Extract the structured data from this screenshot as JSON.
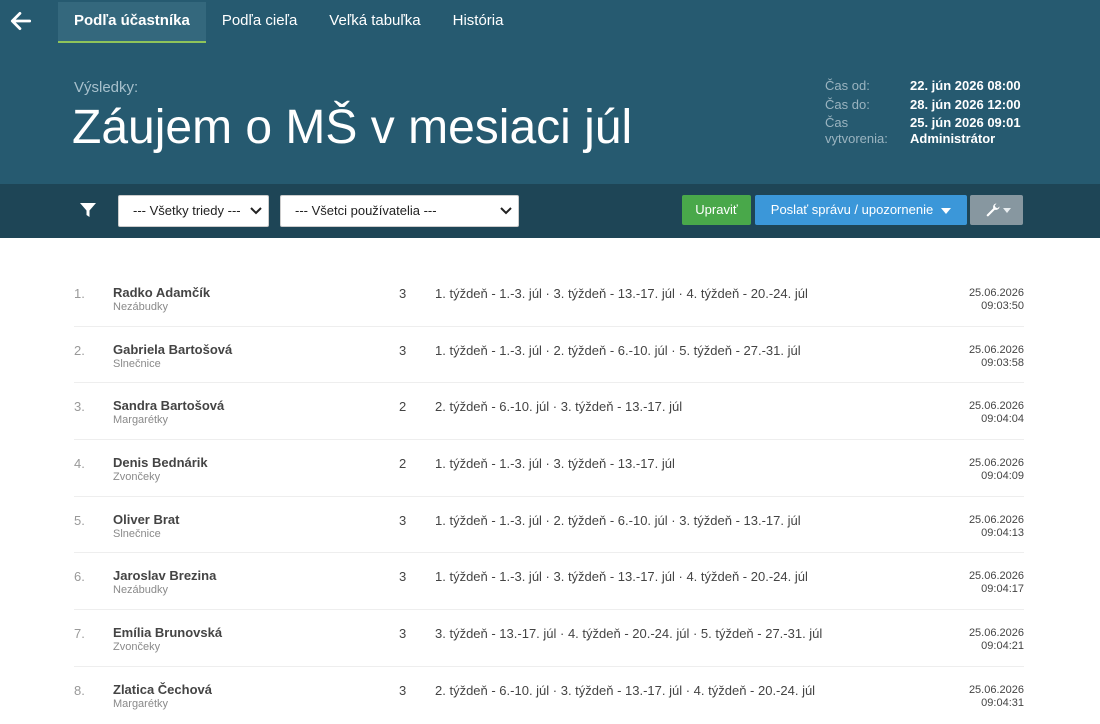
{
  "nav": {
    "back_icon": "arrow-left-icon",
    "tabs": [
      {
        "label": "Podľa účastníka",
        "active": true
      },
      {
        "label": "Podľa cieľa",
        "active": false
      },
      {
        "label": "Veľká tabuľka",
        "active": false
      },
      {
        "label": "História",
        "active": false
      }
    ]
  },
  "header": {
    "results_label": "Výsledky:",
    "title": "Záujem o MŠ v mesiaci júl",
    "meta": {
      "time_from_label": "Čas od:",
      "time_from": "22. jún 2026 08:00",
      "time_to_label": "Čas do:",
      "time_to": "28. jún 2026 12:00",
      "created_label": "Čas vytvorenia:",
      "created_time": "25. jún 2026 09:01",
      "created_by": "Administrátor"
    }
  },
  "toolbar": {
    "filter_icon": "filter-icon",
    "classes_select": "--- Všetky triedy ---",
    "users_select": "--- Všetci používatelia ---",
    "edit_label": "Upraviť",
    "send_label": "Poslať správu / upozornenie",
    "tools_icon": "wrench-icon",
    "colors": {
      "edit": "#49a84a",
      "send": "#3b97d9",
      "tools": "#8797a0"
    }
  },
  "rows": [
    {
      "num": "1.",
      "name": "Radko Adamčík",
      "group": "Nezábudky",
      "count": "3",
      "choices": "1. týždeň - 1.-3. júl · 3. týždeň - 13.-17. júl · 4. týždeň - 20.-24. júl",
      "date": "25.06.2026",
      "time": "09:03:50"
    },
    {
      "num": "2.",
      "name": "Gabriela Bartošová",
      "group": "Slnečnice",
      "count": "3",
      "choices": "1. týždeň - 1.-3. júl · 2. týždeň - 6.-10. júl · 5. týždeň - 27.-31. júl",
      "date": "25.06.2026",
      "time": "09:03:58"
    },
    {
      "num": "3.",
      "name": "Sandra Bartošová",
      "group": "Margarétky",
      "count": "2",
      "choices": "2. týždeň - 6.-10. júl · 3. týždeň - 13.-17. júl",
      "date": "25.06.2026",
      "time": "09:04:04"
    },
    {
      "num": "4.",
      "name": "Denis Bednárik",
      "group": "Zvončeky",
      "count": "2",
      "choices": "1. týždeň - 1.-3. júl · 3. týždeň - 13.-17. júl",
      "date": "25.06.2026",
      "time": "09:04:09"
    },
    {
      "num": "5.",
      "name": "Oliver Brat",
      "group": "Slnečnice",
      "count": "3",
      "choices": "1. týždeň - 1.-3. júl · 2. týždeň - 6.-10. júl · 3. týždeň - 13.-17. júl",
      "date": "25.06.2026",
      "time": "09:04:13"
    },
    {
      "num": "6.",
      "name": "Jaroslav Brezina",
      "group": "Nezábudky",
      "count": "3",
      "choices": "1. týždeň - 1.-3. júl · 3. týždeň - 13.-17. júl · 4. týždeň - 20.-24. júl",
      "date": "25.06.2026",
      "time": "09:04:17"
    },
    {
      "num": "7.",
      "name": "Emília Brunovská",
      "group": "Zvončeky",
      "count": "3",
      "choices": "3. týždeň - 13.-17. júl · 4. týždeň - 20.-24. júl · 5. týždeň - 27.-31. júl",
      "date": "25.06.2026",
      "time": "09:04:21"
    },
    {
      "num": "8.",
      "name": "Zlatica Čechová",
      "group": "Margarétky",
      "count": "3",
      "choices": "2. týždeň - 6.-10. júl · 3. týždeň - 13.-17. júl · 4. týždeň - 20.-24. júl",
      "date": "25.06.2026",
      "time": "09:04:31"
    }
  ]
}
